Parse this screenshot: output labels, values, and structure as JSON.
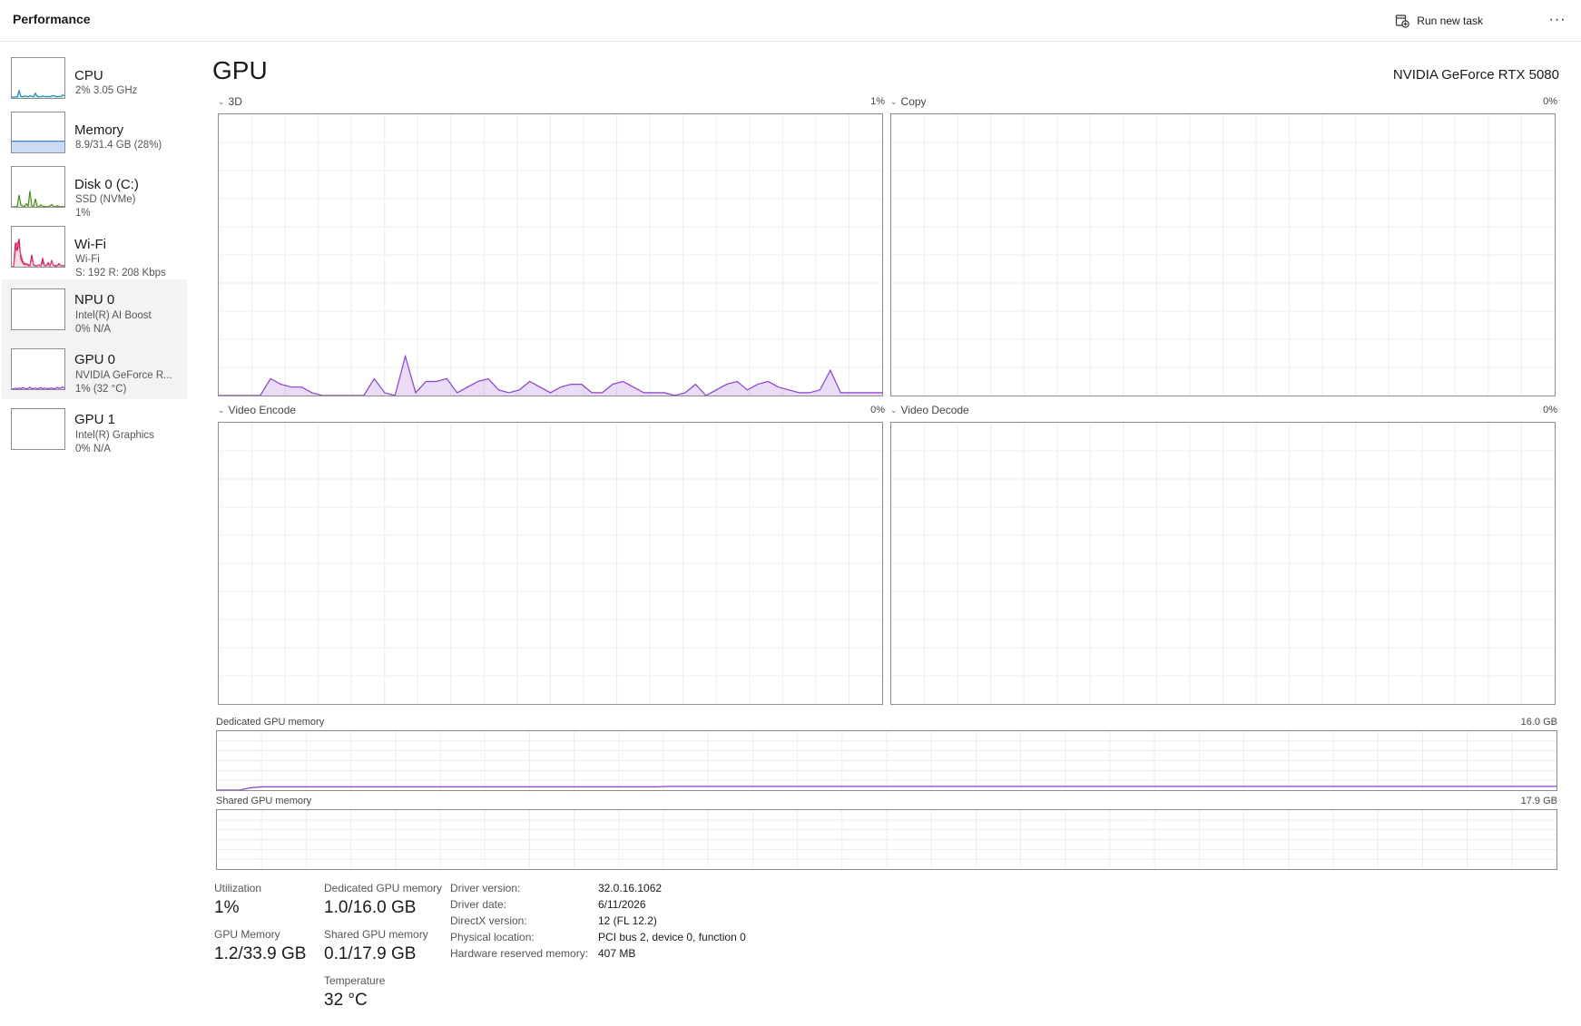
{
  "header": {
    "title": "Performance",
    "run_new_task": "Run new task",
    "more": "···"
  },
  "sidebar": {
    "items": [
      {
        "name": "CPU",
        "line1": "2% 3.05 GHz",
        "line2": "",
        "color": "#1a8bb9"
      },
      {
        "name": "Memory",
        "line1": "8.9/31.4 GB (28%)",
        "line2": "",
        "color": "#2f6fd6"
      },
      {
        "name": "Disk 0 (C:)",
        "line1": "SSD (NVMe)",
        "line2": "1%",
        "color": "#4f8c1f"
      },
      {
        "name": "Wi-Fi",
        "line1": "Wi-Fi",
        "line2": "S: 192 R: 208 Kbps",
        "color": "#c2185b"
      },
      {
        "name": "NPU 0",
        "line1": "Intel(R) AI Boost",
        "line2": "0% N/A",
        "color": "#8a3fd1"
      },
      {
        "name": "GPU 0",
        "line1": "NVIDIA GeForce R...",
        "line2": "1% (32 °C)",
        "color": "#8a3fd1"
      },
      {
        "name": "GPU 1",
        "line1": "Intel(R) Graphics",
        "line2": "0% N/A",
        "color": "#8a3fd1"
      }
    ],
    "sparklines": {
      "cpu": [
        2,
        2,
        3,
        2,
        18,
        4,
        3,
        5,
        4,
        3,
        6,
        4,
        3,
        12,
        4,
        3,
        3,
        5,
        4,
        3,
        4,
        3,
        5,
        6,
        4,
        3,
        4,
        3,
        8,
        5
      ],
      "memory": [
        28,
        28,
        28,
        28,
        28,
        28,
        28,
        28,
        28,
        28,
        28,
        28,
        28,
        28,
        28,
        28,
        28,
        28,
        28,
        28,
        28,
        28,
        28,
        28,
        28,
        28,
        28,
        28,
        28,
        28
      ],
      "disk": [
        0,
        0,
        0,
        1,
        30,
        5,
        2,
        1,
        8,
        2,
        40,
        3,
        1,
        20,
        1,
        0,
        5,
        2,
        1,
        0,
        1,
        2,
        6,
        1,
        0,
        3,
        1,
        0,
        1,
        0
      ],
      "wifi_send": [
        0,
        0,
        60,
        40,
        70,
        20,
        10,
        5,
        8,
        3,
        2,
        30,
        4,
        2,
        3,
        5,
        2,
        20,
        3,
        2,
        10,
        2,
        15,
        3,
        2,
        2,
        8,
        2,
        3,
        2
      ],
      "wifi_recv": [
        0,
        0,
        40,
        60,
        50,
        30,
        15,
        8,
        5,
        6,
        3,
        20,
        6,
        3,
        2,
        4,
        3,
        10,
        4,
        3,
        6,
        3,
        12,
        4,
        3,
        3,
        5,
        3,
        2,
        3
      ],
      "gpu0": [
        0,
        1,
        2,
        1,
        3,
        1,
        4,
        2,
        1,
        2,
        5,
        1,
        2,
        3,
        1,
        2,
        4,
        1,
        3,
        2,
        1,
        2,
        3,
        1,
        2,
        4,
        2,
        3,
        6,
        2
      ]
    }
  },
  "main": {
    "title": "GPU",
    "model": "NVIDIA GeForce RTX 5080",
    "graph_color": "#8a3fd1",
    "panels": [
      {
        "label": "3D",
        "value": "1%"
      },
      {
        "label": "Copy",
        "value": "0%"
      },
      {
        "label": "Video Encode",
        "value": "0%"
      },
      {
        "label": "Video Decode",
        "value": "0%"
      }
    ],
    "utilization_3d_series": [
      0,
      0,
      0,
      0,
      0,
      0,
      0,
      0,
      0,
      0,
      0,
      5,
      2,
      0,
      1,
      0,
      0,
      0,
      0,
      0,
      7,
      3,
      0,
      1,
      0,
      0,
      0,
      0,
      0,
      0,
      0,
      0,
      0,
      0,
      0,
      0,
      0,
      0,
      0,
      0,
      0,
      0,
      0,
      0,
      0,
      0,
      0,
      0,
      0,
      0,
      0,
      0,
      0,
      0,
      0,
      0,
      0,
      0,
      0,
      0,
      0,
      0,
      0,
      0,
      0,
      0,
      0,
      0,
      0,
      0,
      0,
      0,
      0,
      0,
      0,
      0,
      0,
      0,
      0,
      0,
      0,
      0,
      0,
      0,
      0,
      0,
      0,
      0,
      0,
      0,
      0,
      0,
      0,
      0,
      0,
      0,
      0,
      0,
      0,
      0,
      0,
      0
    ],
    "dedicated_memory": {
      "label": "Dedicated GPU memory",
      "max": "16.0 GB"
    },
    "shared_memory": {
      "label": "Shared GPU memory",
      "max": "17.9 GB"
    },
    "stats": {
      "utilization_label": "Utilization",
      "utilization": "1%",
      "gpu_memory_label": "GPU Memory",
      "gpu_memory": "1.2/33.9 GB",
      "dedicated_label": "Dedicated GPU memory",
      "dedicated": "1.0/16.0 GB",
      "shared_label": "Shared GPU memory",
      "shared": "0.1/17.9 GB",
      "temperature_label": "Temperature",
      "temperature": "32 °C"
    },
    "info": [
      {
        "label": "Driver version:",
        "value": "32.0.16.1062"
      },
      {
        "label": "Driver date:",
        "value": "6/11/2026"
      },
      {
        "label": "DirectX version:",
        "value": "12 (FL 12.2)"
      },
      {
        "label": "Physical location:",
        "value": "PCI bus 2, device 0, function 0"
      },
      {
        "label": "Hardware reserved memory:",
        "value": "407 MB"
      }
    ]
  }
}
